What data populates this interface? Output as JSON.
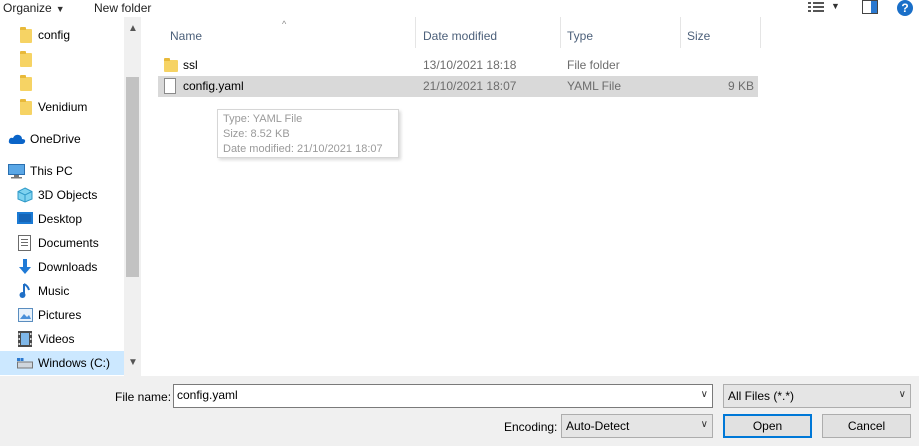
{
  "toolbar": {
    "organize_label": "Organize",
    "organize_caret": "▼",
    "new_folder_label": "New folder",
    "view_caret": "▼",
    "help_label": "?"
  },
  "nav": {
    "items": [
      {
        "label": "config",
        "icon": "folder-icon"
      },
      {
        "label": "",
        "icon": "folder-icon"
      },
      {
        "label": "",
        "icon": "folder-icon"
      },
      {
        "label": "Venidium",
        "icon": "folder-icon"
      },
      {
        "label": "OneDrive",
        "icon": "onedrive-icon"
      },
      {
        "label": "This PC",
        "icon": "this-pc-icon"
      },
      {
        "label": "3D Objects",
        "icon": "3d-objects-icon"
      },
      {
        "label": "Desktop",
        "icon": "desktop-icon"
      },
      {
        "label": "Documents",
        "icon": "documents-icon"
      },
      {
        "label": "Downloads",
        "icon": "downloads-icon"
      },
      {
        "label": "Music",
        "icon": "music-icon"
      },
      {
        "label": "Pictures",
        "icon": "pictures-icon"
      },
      {
        "label": "Videos",
        "icon": "videos-icon"
      },
      {
        "label": "Windows (C:)",
        "icon": "drive-icon"
      }
    ],
    "scroll_up": "▲",
    "scroll_down": "▼"
  },
  "columns": {
    "name": "Name",
    "date": "Date modified",
    "type": "Type",
    "size": "Size",
    "sort_arrow": "^"
  },
  "files": [
    {
      "name": "ssl",
      "date": "13/10/2021 18:18",
      "type": "File folder",
      "size": ""
    },
    {
      "name": "config.yaml",
      "date": "21/10/2021 18:07",
      "type": "YAML File",
      "size": "9 KB"
    }
  ],
  "tooltip": {
    "type": "Type: YAML File",
    "size": "Size: 8.52 KB",
    "date": "Date modified: 21/10/2021 18:07"
  },
  "bottom": {
    "filename_label": "File name:",
    "filename_value": "config.yaml",
    "filter_value": "All Files  (*.*)",
    "encoding_label": "Encoding:",
    "encoding_value": "Auto-Detect",
    "open_label": "Open",
    "cancel_label": "Cancel",
    "dropdown_caret": "∨"
  }
}
